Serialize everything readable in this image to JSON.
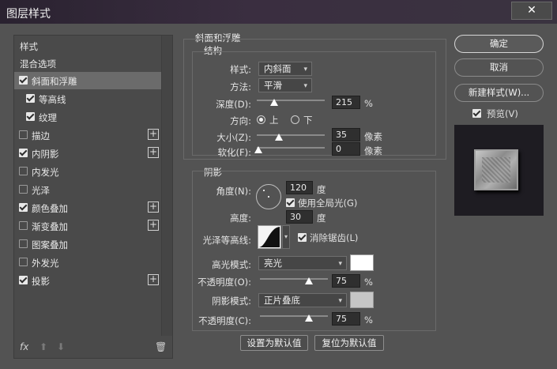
{
  "window": {
    "title": "图层样式",
    "close": "✕"
  },
  "left_panel": {
    "items": [
      {
        "label": "样式",
        "checkbox": "none",
        "plus": false,
        "selected": false
      },
      {
        "label": "混合选项",
        "checkbox": "none",
        "plus": false,
        "selected": false
      },
      {
        "label": "斜面和浮雕",
        "checkbox": "on",
        "plus": false,
        "selected": true
      },
      {
        "label": "等高线",
        "checkbox": "on",
        "plus": false,
        "selected": false,
        "indent": true
      },
      {
        "label": "纹理",
        "checkbox": "on",
        "plus": false,
        "selected": false,
        "indent": true
      },
      {
        "label": "描边",
        "checkbox": "off",
        "plus": true,
        "selected": false
      },
      {
        "label": "内阴影",
        "checkbox": "on",
        "plus": true,
        "selected": false
      },
      {
        "label": "内发光",
        "checkbox": "off",
        "plus": false,
        "selected": false
      },
      {
        "label": "光泽",
        "checkbox": "off",
        "plus": false,
        "selected": false
      },
      {
        "label": "颜色叠加",
        "checkbox": "on",
        "plus": true,
        "selected": false
      },
      {
        "label": "渐变叠加",
        "checkbox": "off",
        "plus": true,
        "selected": false
      },
      {
        "label": "图案叠加",
        "checkbox": "off",
        "plus": false,
        "selected": false
      },
      {
        "label": "外发光",
        "checkbox": "off",
        "plus": false,
        "selected": false
      },
      {
        "label": "投影",
        "checkbox": "on",
        "plus": true,
        "selected": false
      }
    ],
    "bottom": {
      "fx": "fx",
      "up": "⬆",
      "down": "⬇",
      "trash": "🗑"
    }
  },
  "bevel": {
    "group_title": "斜面和浮雕",
    "structure_title": "结构",
    "style_label": "样式:",
    "style_value": "内斜面",
    "technique_label": "方法:",
    "technique_value": "平滑",
    "depth_label": "深度(D):",
    "depth_value": "215",
    "depth_unit": "%",
    "direction_label": "方向:",
    "direction_up": "上",
    "direction_down": "下",
    "size_label": "大小(Z):",
    "size_value": "35",
    "size_unit": "像素",
    "soften_label": "软化(F):",
    "soften_value": "0",
    "soften_unit": "像素"
  },
  "shading": {
    "title": "阴影",
    "angle_label": "角度(N):",
    "angle_value": "120",
    "angle_unit": "度",
    "global_light_label": "使用全局光(G)",
    "altitude_label": "高度:",
    "altitude_value": "30",
    "altitude_unit": "度",
    "gloss_label": "光泽等高线:",
    "antialias_label": "消除锯齿(L)",
    "highlight_label": "高光模式:",
    "highlight_mode": "亮光",
    "highlight_color": "#ffffff",
    "highlight_opacity_label": "不透明度(O):",
    "highlight_opacity": "75",
    "highlight_opacity_unit": "%",
    "shadow_label": "阴影模式:",
    "shadow_mode": "正片叠底",
    "shadow_color": "#c6c6c6",
    "shadow_opacity_label": "不透明度(C):",
    "shadow_opacity": "75",
    "shadow_opacity_unit": "%"
  },
  "footer_buttons": {
    "set_default": "设置为默认值",
    "reset_default": "复位为默认值"
  },
  "right": {
    "ok": "确定",
    "cancel": "取消",
    "new_style": "新建样式(W)...",
    "preview_label": "预览(V)"
  },
  "slider_levels": {
    "depth": 0.215,
    "size": 0.35,
    "soften": 0.0,
    "highlight_opacity": 0.75,
    "shadow_opacity": 0.75
  }
}
